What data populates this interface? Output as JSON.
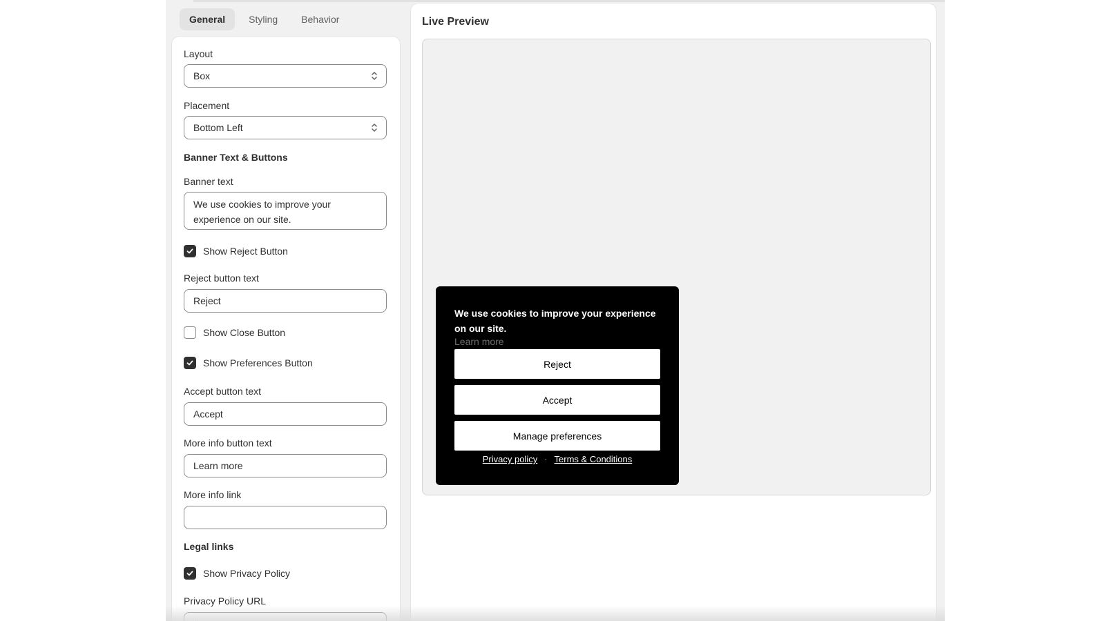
{
  "tabs": [
    "General",
    "Styling",
    "Behavior"
  ],
  "active_tab": "General",
  "settings": {
    "layout_label": "Layout",
    "layout_value": "Box",
    "placement_label": "Placement",
    "placement_value": "Bottom Left",
    "section_banner": "Banner Text & Buttons",
    "banner_text_label": "Banner text",
    "banner_text_value": "We use cookies to improve your experience on our site.",
    "show_reject": {
      "label": "Show Reject Button",
      "checked": true
    },
    "reject_label": "Reject button text",
    "reject_value": "Reject",
    "show_close": {
      "label": "Show Close Button",
      "checked": false
    },
    "show_preferences": {
      "label": "Show Preferences Button",
      "checked": true
    },
    "accept_label": "Accept button text",
    "accept_value": "Accept",
    "more_info_label": "More info button text",
    "more_info_value": "Learn more",
    "more_info_link_label": "More info link",
    "more_info_link_value": "",
    "section_legal": "Legal links",
    "show_privacy": {
      "label": "Show Privacy Policy",
      "checked": true
    },
    "privacy_url_label": "Privacy Policy URL",
    "privacy_url_value": "#"
  },
  "preview": {
    "title": "Live Preview",
    "banner_text": "We use cookies to improve your experience on our site.",
    "learn_more": "Learn more",
    "reject": "Reject",
    "accept": "Accept",
    "manage": "Manage preferences",
    "privacy_link": "Privacy policy",
    "separator": "·",
    "terms_link": "Terms & Conditions"
  },
  "colors": {
    "banner_bg": "#000000",
    "button_bg": "#ffffff",
    "checkbox_checked": "#303030"
  }
}
